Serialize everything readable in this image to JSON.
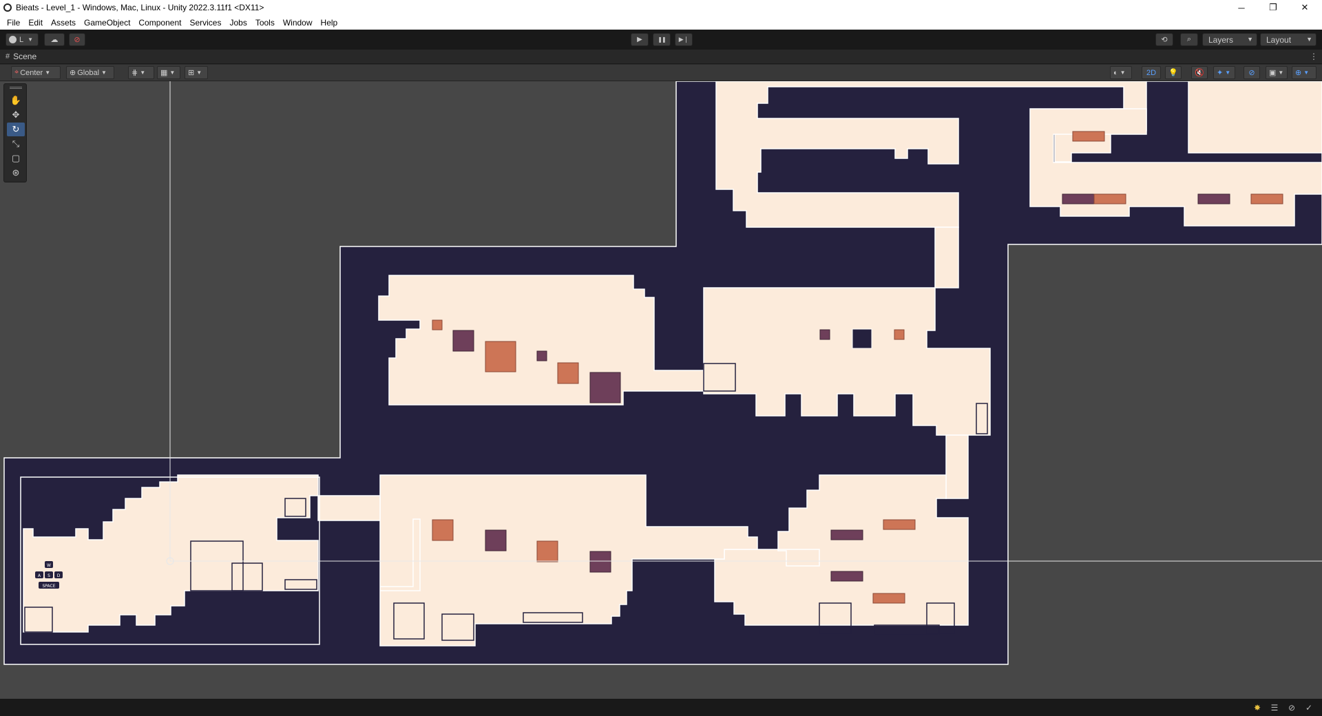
{
  "window": {
    "title": "Bieats - Level_1 - Windows, Mac, Linux - Unity 2022.3.11f1 <DX11>",
    "controls": {
      "minimize": "─",
      "restore": "❐",
      "close": "✕"
    }
  },
  "menu": [
    "File",
    "Edit",
    "Assets",
    "GameObject",
    "Component",
    "Services",
    "Jobs",
    "Tools",
    "Window",
    "Help"
  ],
  "toolbar": {
    "account_label": "L",
    "play_icon": "▶",
    "pause_icon": "❚❚",
    "step_icon": "▶❘",
    "layers_label": "Layers",
    "layout_label": "Layout"
  },
  "scene": {
    "tab_label": "Scene",
    "pivot_label": "Center",
    "space_label": "Global",
    "mode_2d_label": "2D"
  },
  "tools": [
    "hand-tool",
    "move-tool",
    "rotate-tool",
    "scale-tool",
    "rect-tool",
    "transform-tool"
  ],
  "active_tool": "rotate-tool",
  "level_signs": {
    "keys": [
      "W",
      "A",
      "S",
      "D"
    ],
    "space_label": "SPACE"
  },
  "colors": {
    "floor": "#fcebdb",
    "wall": "#25213e",
    "outline": "#ffffff",
    "crate_orange": "#cd7556",
    "crate_purple": "#6e3f5a",
    "viewport_bg": "#474747",
    "accent": "#3a5a86"
  }
}
